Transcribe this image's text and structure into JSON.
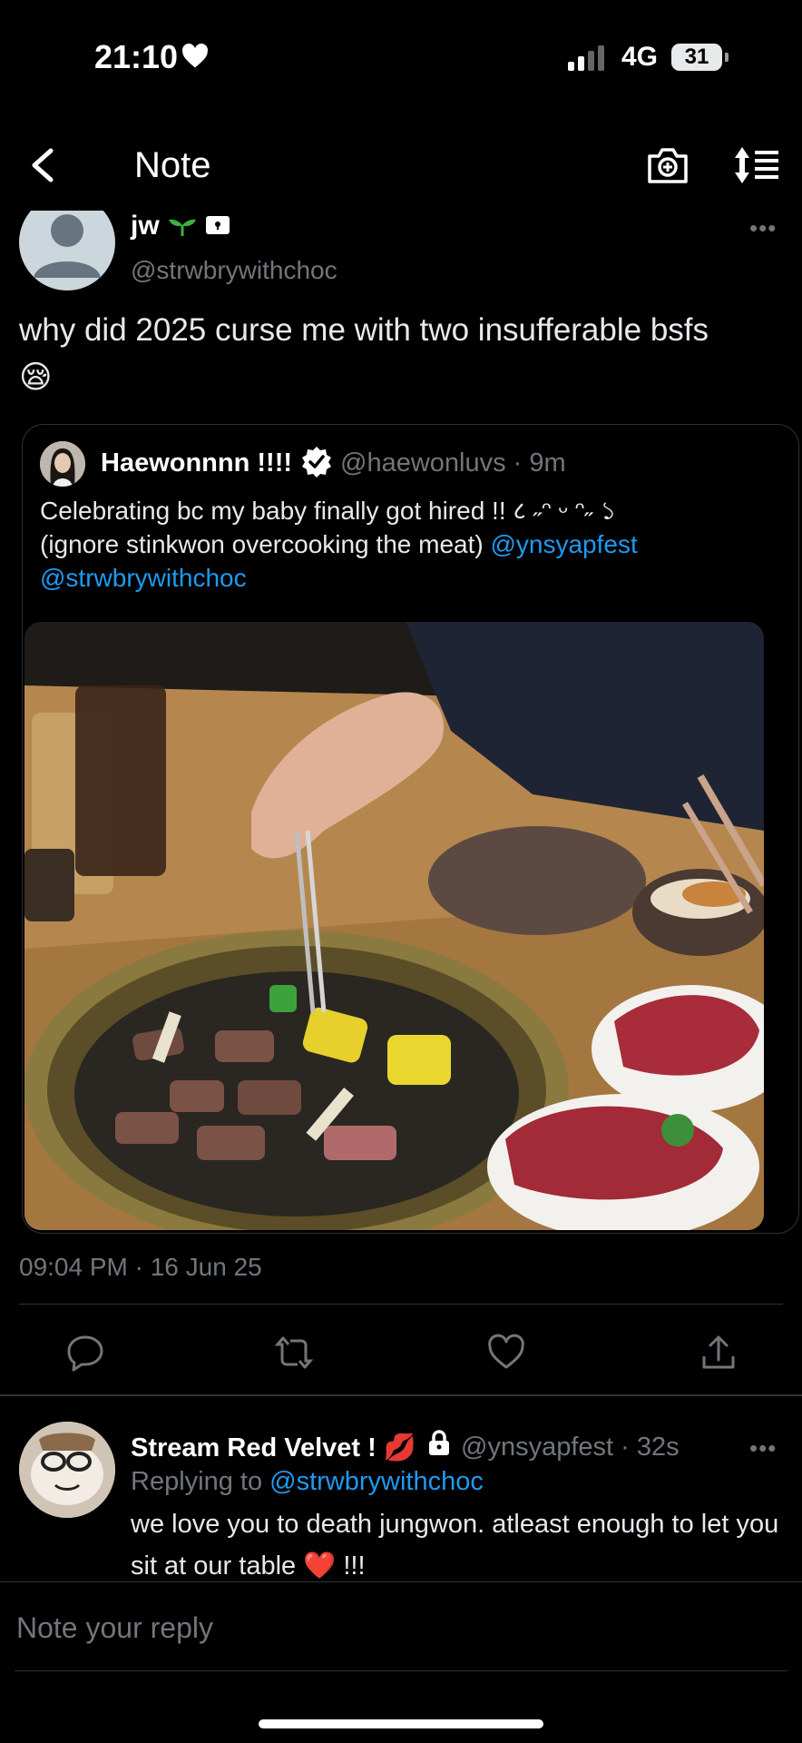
{
  "status_bar": {
    "time": "21:10",
    "network": "4G",
    "battery": "31"
  },
  "nav": {
    "title": "Note"
  },
  "tweet": {
    "author": "jw",
    "handle": "@strwbrywithchoc",
    "text": "why did 2025 curse me with two insufferable bsfs 😪",
    "timestamp": "09:04 PM · 16 Jun 25"
  },
  "quote": {
    "name": "Haewonnnn !!!!",
    "handle_time": "@haewonluvs · 9m",
    "text_line1": "Celebrating bc my baby finally got hired !! ८ ˶ᵔ ᵕ ᵔ˶ ১",
    "text_line2": "(ignore stinkwon overcooking the meat) ",
    "mention1": "@ynsyapfest",
    "mention2": "@strwbrywithchoc"
  },
  "reply": {
    "name": "Stream Red Velvet ! 💋",
    "handle_time": "@ynsyapfest · 32s",
    "replying_prefix": "Replying to ",
    "replying_to": "@strwbrywithchoc",
    "text": "we love you to death jungwon. atleast enough to let you sit at our table ❤️  !!!"
  },
  "composer": {
    "placeholder": "Note your reply"
  },
  "colors": {
    "accent": "#1d9bf0",
    "muted": "#71767b",
    "background": "#000000"
  }
}
